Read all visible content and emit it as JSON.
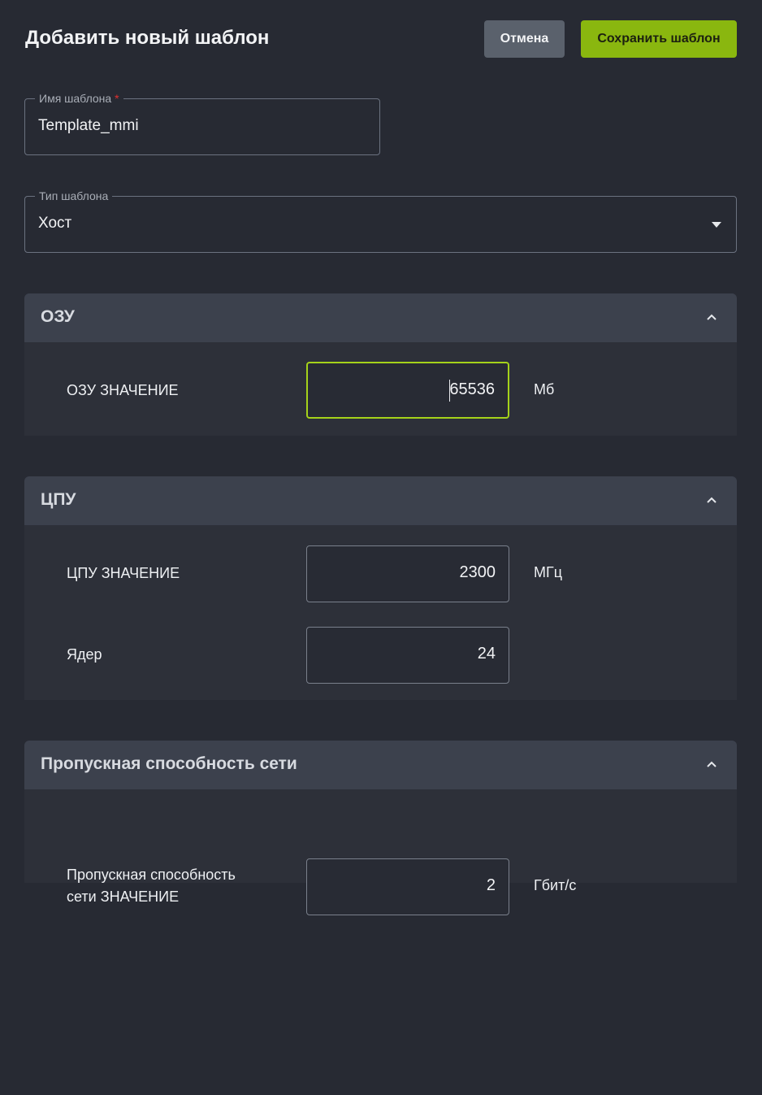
{
  "header": {
    "title": "Добавить новый шаблон",
    "cancel_label": "Отмена",
    "save_label": "Сохранить шаблон"
  },
  "form": {
    "name": {
      "label": "Имя шаблона",
      "required_mark": "*",
      "value": "Template_mmi"
    },
    "type": {
      "label": "Тип шаблона",
      "value": "Хост"
    }
  },
  "sections": {
    "ram": {
      "title": "ОЗУ",
      "rows": [
        {
          "label": "ОЗУ ЗНАЧЕНИЕ",
          "value": "65536",
          "unit": "Мб"
        }
      ]
    },
    "cpu": {
      "title": "ЦПУ",
      "rows": [
        {
          "label": "ЦПУ ЗНАЧЕНИЕ",
          "value": "2300",
          "unit": "МГц"
        },
        {
          "label": "Ядер",
          "value": "24",
          "unit": ""
        }
      ]
    },
    "network": {
      "title": "Пропускная способность сети",
      "rows": [
        {
          "label_line1": "Пропускная способность",
          "label_line2": "сети ЗНАЧЕНИЕ",
          "value": "2",
          "unit": "Гбит/с"
        }
      ]
    }
  },
  "colors": {
    "background": "#272a33",
    "accent": "#8ab70f",
    "focus_border": "#a5d21a",
    "required": "#e0302f"
  },
  "icons": {
    "dropdown": "caret-down-icon",
    "collapse": "chevron-up-icon"
  }
}
